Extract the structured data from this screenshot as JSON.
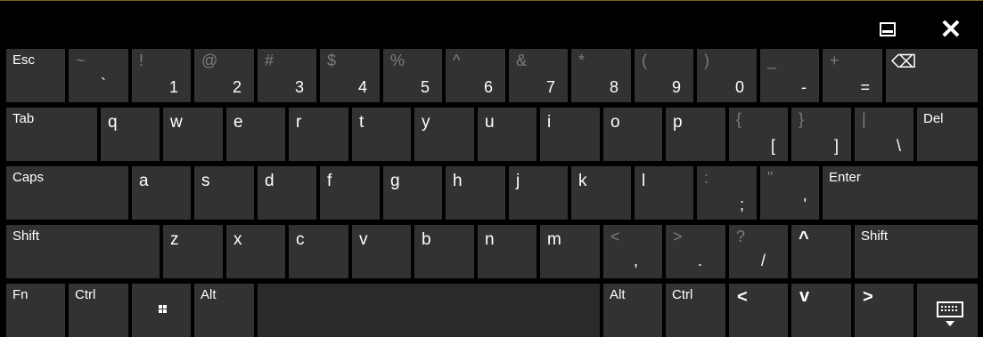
{
  "window": {
    "minimize_label": "▭",
    "close_label": "✕"
  },
  "keys": {
    "esc": "Esc",
    "backtick": {
      "shift": "~",
      "main": "`"
    },
    "1": {
      "shift": "!",
      "main": "1"
    },
    "2": {
      "shift": "@",
      "main": "2"
    },
    "3": {
      "shift": "#",
      "main": "3"
    },
    "4": {
      "shift": "$",
      "main": "4"
    },
    "5": {
      "shift": "%",
      "main": "5"
    },
    "6": {
      "shift": "^",
      "main": "6"
    },
    "7": {
      "shift": "&",
      "main": "7"
    },
    "8": {
      "shift": "*",
      "main": "8"
    },
    "9": {
      "shift": "(",
      "main": "9"
    },
    "0": {
      "shift": ")",
      "main": "0"
    },
    "minus": {
      "shift": "_",
      "main": "-"
    },
    "equals": {
      "shift": "+",
      "main": "="
    },
    "backspace_icon": "⌫",
    "tab": "Tab",
    "q": "q",
    "w": "w",
    "e": "e",
    "r": "r",
    "t": "t",
    "y": "y",
    "u": "u",
    "i": "i",
    "o": "o",
    "p": "p",
    "lbracket": {
      "shift": "{",
      "main": "["
    },
    "rbracket": {
      "shift": "}",
      "main": "]"
    },
    "backslash": {
      "shift": "|",
      "main": "\\"
    },
    "del": "Del",
    "caps": "Caps",
    "a": "a",
    "s": "s",
    "d": "d",
    "f": "f",
    "g": "g",
    "h": "h",
    "j": "j",
    "k": "k",
    "l": "l",
    "semicolon": {
      "shift": ":",
      "main": ";"
    },
    "quote": {
      "shift": "\"",
      "main": "'"
    },
    "enter": "Enter",
    "shift": "Shift",
    "z": "z",
    "x": "x",
    "c": "c",
    "v": "v",
    "b": "b",
    "n": "n",
    "m": "m",
    "comma": {
      "shift": "<",
      "main": ","
    },
    "period": {
      "shift": ">",
      "main": "."
    },
    "slash": {
      "shift": "?",
      "main": "/"
    },
    "up_arrow": "^",
    "fn": "Fn",
    "ctrl": "Ctrl",
    "alt": "Alt",
    "left_arrow": "<",
    "down_arrow": "v",
    "right_arrow": ">"
  }
}
